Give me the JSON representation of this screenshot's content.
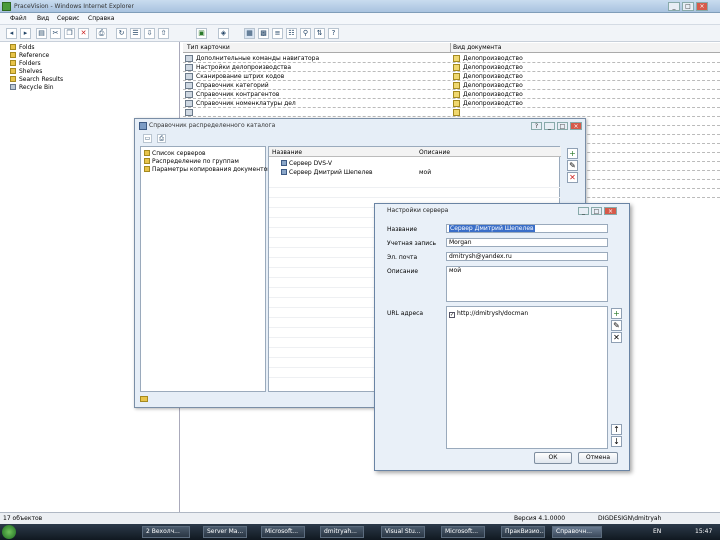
{
  "window": {
    "title": "PraceVision - Windows Internet Explorer"
  },
  "menu": [
    "Файл",
    "Вид",
    "Сервис",
    "Справка"
  ],
  "tree": [
    {
      "label": "Folds"
    },
    {
      "label": "Reference"
    },
    {
      "label": "Folders"
    },
    {
      "label": "Shelves"
    },
    {
      "label": "Search Results"
    },
    {
      "label": "Recycle Bin"
    }
  ],
  "list": {
    "headers": [
      "Тип карточки",
      "Вид документа"
    ],
    "rows": [
      {
        "name": "Дополнительные команды навигатора",
        "category": "Делопроизводство"
      },
      {
        "name": "Настройки делопроизводства",
        "category": "Делопроизводство"
      },
      {
        "name": "Сканирование штрих кодов",
        "category": "Делопроизводство"
      },
      {
        "name": "Справочник категорий",
        "category": "Делопроизводство"
      },
      {
        "name": "Справочник контрагентов",
        "category": "Делопроизводство"
      },
      {
        "name": "Справочник номенклатуры дел",
        "category": "Делопроизводство"
      }
    ]
  },
  "status": {
    "left": "17 объектов",
    "version": "Версия 4.1.0000",
    "user": "DIGDESIGN\\dmitryah"
  },
  "taskbar": {
    "items": [
      "2 Вехолч...",
      "Server Ma...",
      "Microsoft...",
      "dmitryah...",
      "Visual Stu...",
      "Microsoft...",
      "ПракВизио...",
      "Справочн..."
    ],
    "clock": "15:47",
    "lang": "EN"
  },
  "dialog1": {
    "title": "Справочник распределенного каталога",
    "left_items": [
      "Список серверов",
      "Распределение по группам",
      "Параметры копирования документов"
    ],
    "columns": [
      "Название",
      "Описание"
    ],
    "rows": [
      {
        "name": "Сервер DVS-V",
        "desc": ""
      },
      {
        "name": "Сервер Дмитрий Шепелев",
        "desc": "мой"
      }
    ]
  },
  "dialog2": {
    "title": "Настройки сервера",
    "fields": {
      "name_label": "Название",
      "name_value": "Сервер Дмитрий Шепелев",
      "login_label": "Учетная запись",
      "login_value": "Morgan",
      "email_label": "Эл. почта",
      "email_value": "dmitrysh@yandex.ru",
      "desc_label": "Описание",
      "desc_value": "мой",
      "url_label": "URL адреса",
      "url_value": "http://dmitrysh/docman"
    },
    "ok": "ОК",
    "cancel": "Отмена"
  }
}
